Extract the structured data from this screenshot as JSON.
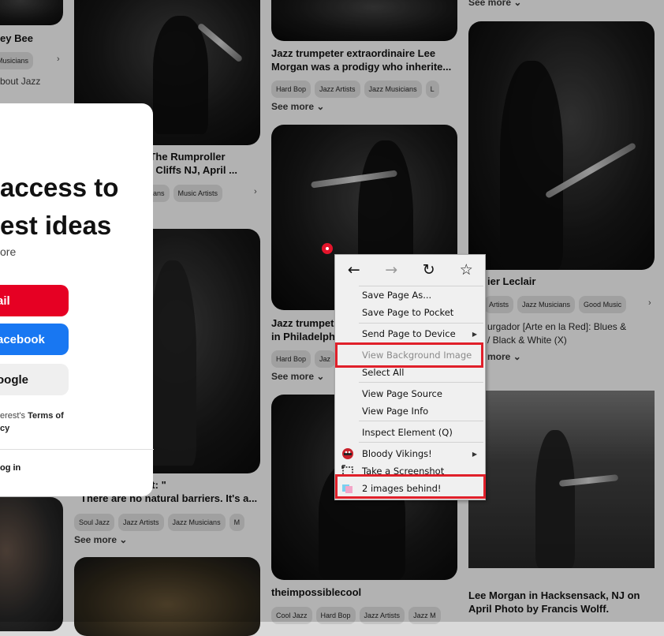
{
  "pins": {
    "col0": {
      "title_fragment": "ey Bee",
      "tags": [
        "Musicians"
      ],
      "desc_fragment": "bout Jazz"
    },
    "col1": {
      "pin1_title": "ng The Rumproller\nood Cliffs NJ, April ...",
      "pin1_tags": [
        "usicians",
        "Music Artists"
      ],
      "pin2_title": "inthegreenshirt: \"\nThere are no natural barriers. It's a...",
      "pin2_tags": [
        "Soul Jazz",
        "Jazz Artists",
        "Jazz Musicians",
        "M"
      ],
      "see_more": "See more"
    },
    "col2": {
      "pin1_title": "Jazz trumpeter extraordinaire Lee\nMorgan was a prodigy who inherite...",
      "pin1_tags": [
        "Hard Bop",
        "Jazz Artists",
        "Jazz Musicians",
        "L"
      ],
      "see_more": "See more",
      "pin2_title": "Jazz trumpet\nin Philadelph",
      "pin2_tags": [
        "Hard Bop",
        "Jaz"
      ],
      "pin3_title": "theimpossiblecool",
      "pin3_tags": [
        "Cool Jazz",
        "Hard Bop",
        "Jazz Artists",
        "Jazz M"
      ]
    },
    "col3": {
      "see_more": "See more",
      "pin1_title": "ier Leclair",
      "pin1_tags": [
        "Artists",
        "Jazz Musicians",
        "Good Music"
      ],
      "pin1_desc": "urgador [Arte en la Red]: Blues &\n/ Black & White (X)",
      "pin1_more": "more",
      "pin2_title": "Lee Morgan in Hacksensack, NJ on\nApril Photo by Francis Wolff."
    }
  },
  "modal": {
    "heading_line1": "access to",
    "heading_line2": "est ideas",
    "sub": "ore",
    "email_btn": "ail",
    "facebook_btn": "acebook",
    "google_btn": "oogle",
    "terms_prefix": "erest's ",
    "terms_link": "Terms of",
    "terms_line2": "cy",
    "login": "og in"
  },
  "context_menu": {
    "nav": {
      "back": "←",
      "forward": "→",
      "reload": "↻",
      "bookmark": "☆"
    },
    "items": {
      "save_page_as": "Save Page As...",
      "save_to_pocket": "Save Page to Pocket",
      "send_to_device": "Send Page to Device",
      "view_bg_image": "View Background Image",
      "select_all": "Select All",
      "view_source": "View Page Source",
      "view_info": "View Page Info",
      "inspect": "Inspect Element (Q)",
      "bloody_vikings": "Bloody Vikings!",
      "screenshot": "Take a Screenshot",
      "images_behind": "2 images behind!"
    }
  },
  "colors": {
    "highlight": "#e0202a",
    "email": "#e60023",
    "facebook": "#1877f2"
  }
}
